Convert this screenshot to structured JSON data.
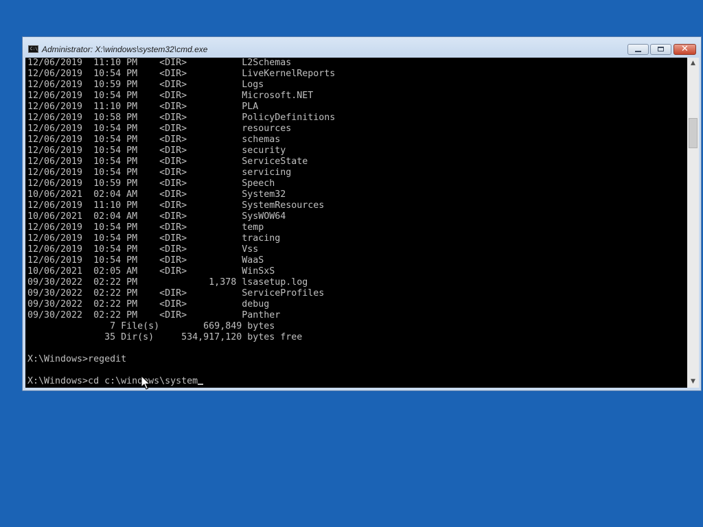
{
  "window": {
    "title": "Administrator: X:\\windows\\system32\\cmd.exe",
    "icon_label": "C:\\",
    "close_glyph": "✕"
  },
  "console": {
    "lines": [
      "12/06/2019  11:10 PM    <DIR>          L2Schemas",
      "12/06/2019  10:54 PM    <DIR>          LiveKernelReports",
      "12/06/2019  10:59 PM    <DIR>          Logs",
      "12/06/2019  10:54 PM    <DIR>          Microsoft.NET",
      "12/06/2019  11:10 PM    <DIR>          PLA",
      "12/06/2019  10:58 PM    <DIR>          PolicyDefinitions",
      "12/06/2019  10:54 PM    <DIR>          resources",
      "12/06/2019  10:54 PM    <DIR>          schemas",
      "12/06/2019  10:54 PM    <DIR>          security",
      "12/06/2019  10:54 PM    <DIR>          ServiceState",
      "12/06/2019  10:54 PM    <DIR>          servicing",
      "12/06/2019  10:59 PM    <DIR>          Speech",
      "10/06/2021  02:04 AM    <DIR>          System32",
      "12/06/2019  11:10 PM    <DIR>          SystemResources",
      "10/06/2021  02:04 AM    <DIR>          SysWOW64",
      "12/06/2019  10:54 PM    <DIR>          temp",
      "12/06/2019  10:54 PM    <DIR>          tracing",
      "12/06/2019  10:54 PM    <DIR>          Vss",
      "12/06/2019  10:54 PM    <DIR>          WaaS",
      "10/06/2021  02:05 AM    <DIR>          WinSxS",
      "09/30/2022  02:22 PM             1,378 lsasetup.log",
      "09/30/2022  02:22 PM    <DIR>          ServiceProfiles",
      "09/30/2022  02:22 PM    <DIR>          debug",
      "09/30/2022  02:22 PM    <DIR>          Panther",
      "               7 File(s)        669,849 bytes",
      "              35 Dir(s)     534,917,120 bytes free",
      "",
      "X:\\Windows>regedit",
      ""
    ],
    "input_line": "X:\\Windows>cd c:\\windows\\system"
  },
  "scrollbar": {
    "up_arrow": "▲",
    "down_arrow": "▼"
  }
}
